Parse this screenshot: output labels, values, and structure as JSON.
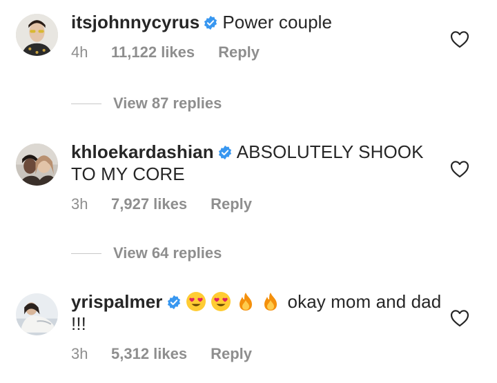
{
  "comments": [
    {
      "username": "itsjohnnycyrus",
      "text": "Power couple",
      "time": "4h",
      "likes": "11,122 likes",
      "reply": "Reply",
      "verified": true
    },
    {
      "username": "khloekardashian",
      "text": "ABSOLUTELY SHOOK TO MY CORE",
      "time": "3h",
      "likes": "7,927 likes",
      "reply": "Reply",
      "verified": true
    },
    {
      "username": "yrispalmer",
      "emojis": [
        "heart-eyes-emoji",
        "heart-eyes-emoji",
        "fire-emoji",
        "fire-emoji"
      ],
      "text": "okay mom and dad !!!",
      "time": "3h",
      "likes": "5,312 likes",
      "reply": "Reply",
      "verified": true
    }
  ],
  "view_replies": [
    {
      "label": "View 87 replies"
    },
    {
      "label": "View 64 replies"
    }
  ],
  "colors": {
    "text": "#262626",
    "muted": "#8e8e8e",
    "verified_blue": "#3897f0"
  }
}
